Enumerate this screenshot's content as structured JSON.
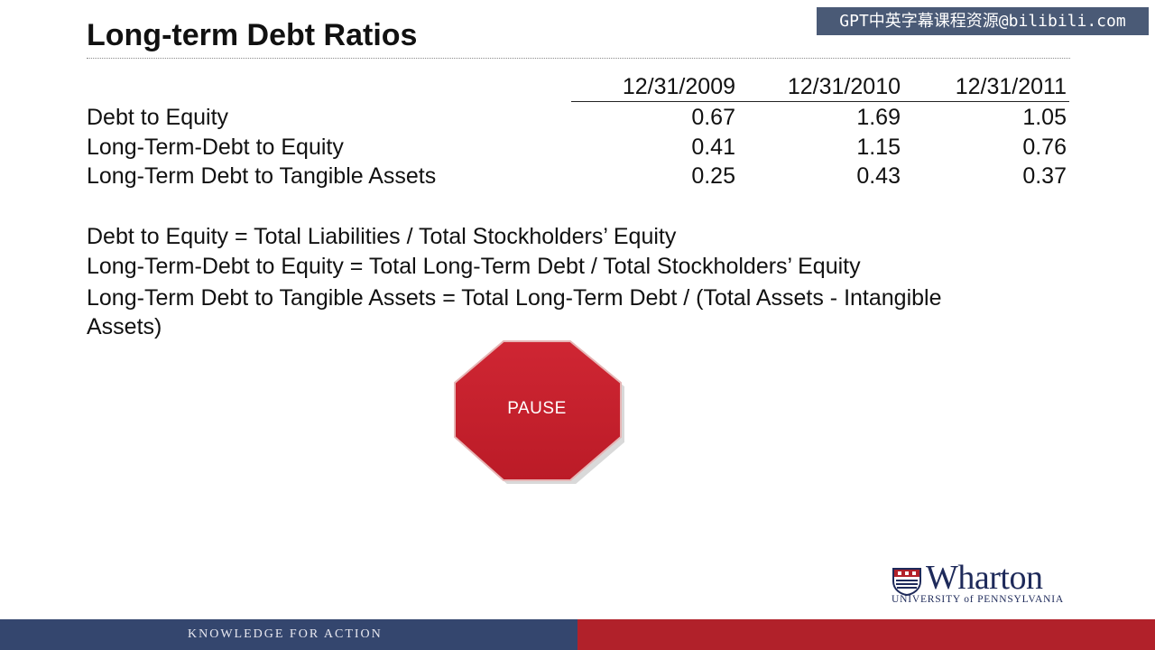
{
  "watermark": "GPT中英字幕课程资源@bilibili.com",
  "slide": {
    "title": "Long-term Debt Ratios",
    "table": {
      "columns": [
        "12/31/2009",
        "12/31/2010",
        "12/31/2011"
      ],
      "rows": [
        {
          "label": "Debt to Equity",
          "values": [
            "0.67",
            "1.69",
            "1.05"
          ]
        },
        {
          "label": "Long-Term-Debt to Equity",
          "values": [
            "0.41",
            "1.15",
            "0.76"
          ]
        },
        {
          "label": "Long-Term Debt to Tangible Assets",
          "values": [
            "0.25",
            "0.43",
            "0.37"
          ]
        }
      ]
    },
    "formulas": [
      "Debt to Equity = Total Liabilities / Total Stockholders’ Equity",
      "Long-Term-Debt to Equity = Total Long-Term Debt / Total Stockholders’ Equity",
      "Long-Term Debt to Tangible Assets = Total Long-Term Debt / (Total Assets - Intangible Assets)"
    ],
    "pause_label": "PAUSE"
  },
  "branding": {
    "logo_word": "Wharton",
    "logo_sub": "UNIVERSITY of PENNSYLVANIA",
    "footer_tagline": "KNOWLEDGE FOR ACTION"
  },
  "colors": {
    "footer_blue": "#34466e",
    "footer_red": "#b1212a",
    "stop_red": "#c8202c",
    "brand_navy": "#1e2a5a"
  }
}
